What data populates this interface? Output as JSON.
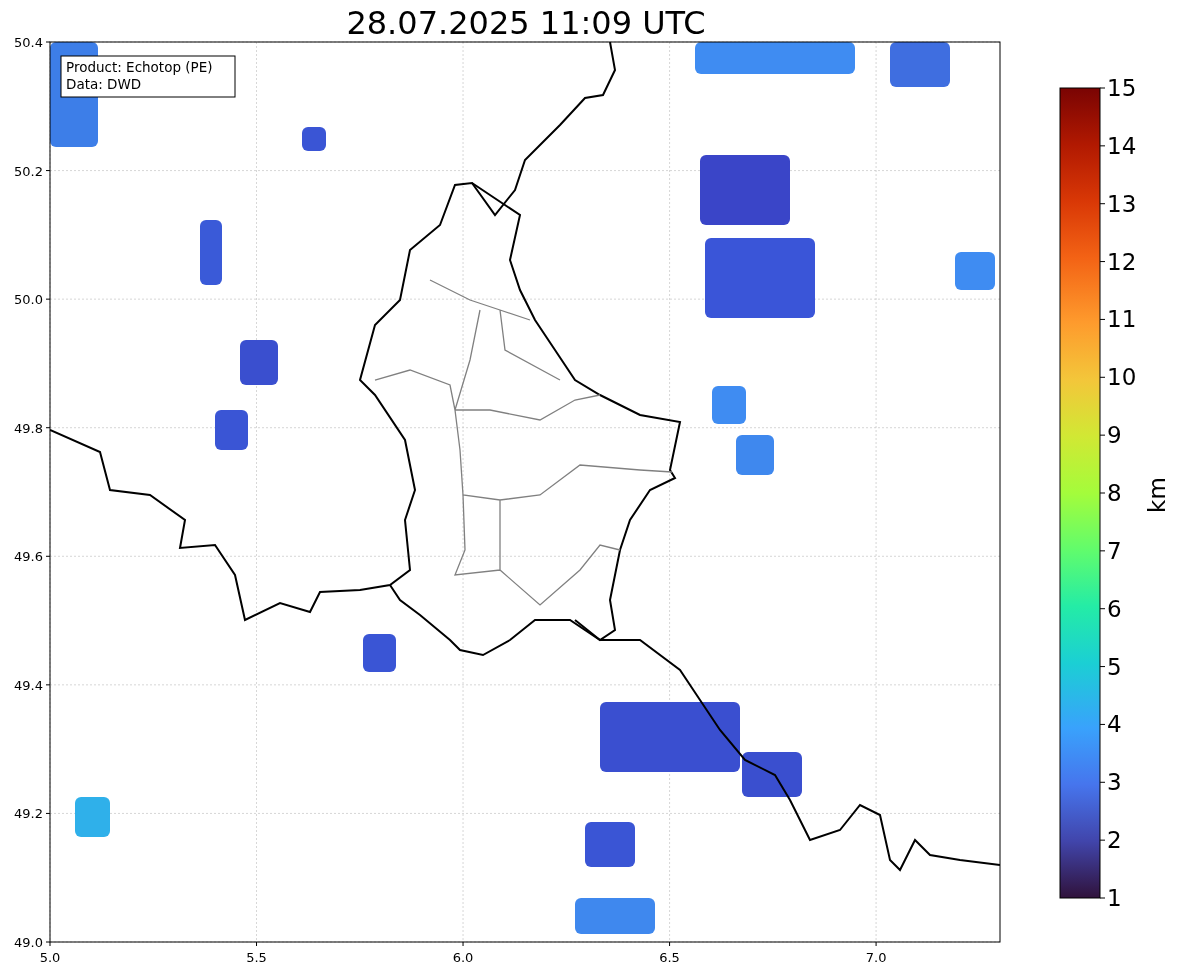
{
  "title": "28.07.2025 11:09 UTC",
  "legend": {
    "lines": [
      "Product: Echotop (PE)",
      "Data: DWD"
    ]
  },
  "map": {
    "xticks": [
      "5.0",
      "5.5",
      "6.0",
      "6.5",
      "7.0"
    ],
    "yticks": [
      "50.4",
      "50.2",
      "50.0",
      "49.8",
      "49.6",
      "49.4",
      "49.2",
      "49.0"
    ]
  },
  "colorbar": {
    "label": "km",
    "ticks": [
      "15",
      "14",
      "13",
      "12",
      "11",
      "10",
      "9",
      "8",
      "7",
      "6",
      "5",
      "4",
      "3",
      "2",
      "1"
    ]
  }
}
